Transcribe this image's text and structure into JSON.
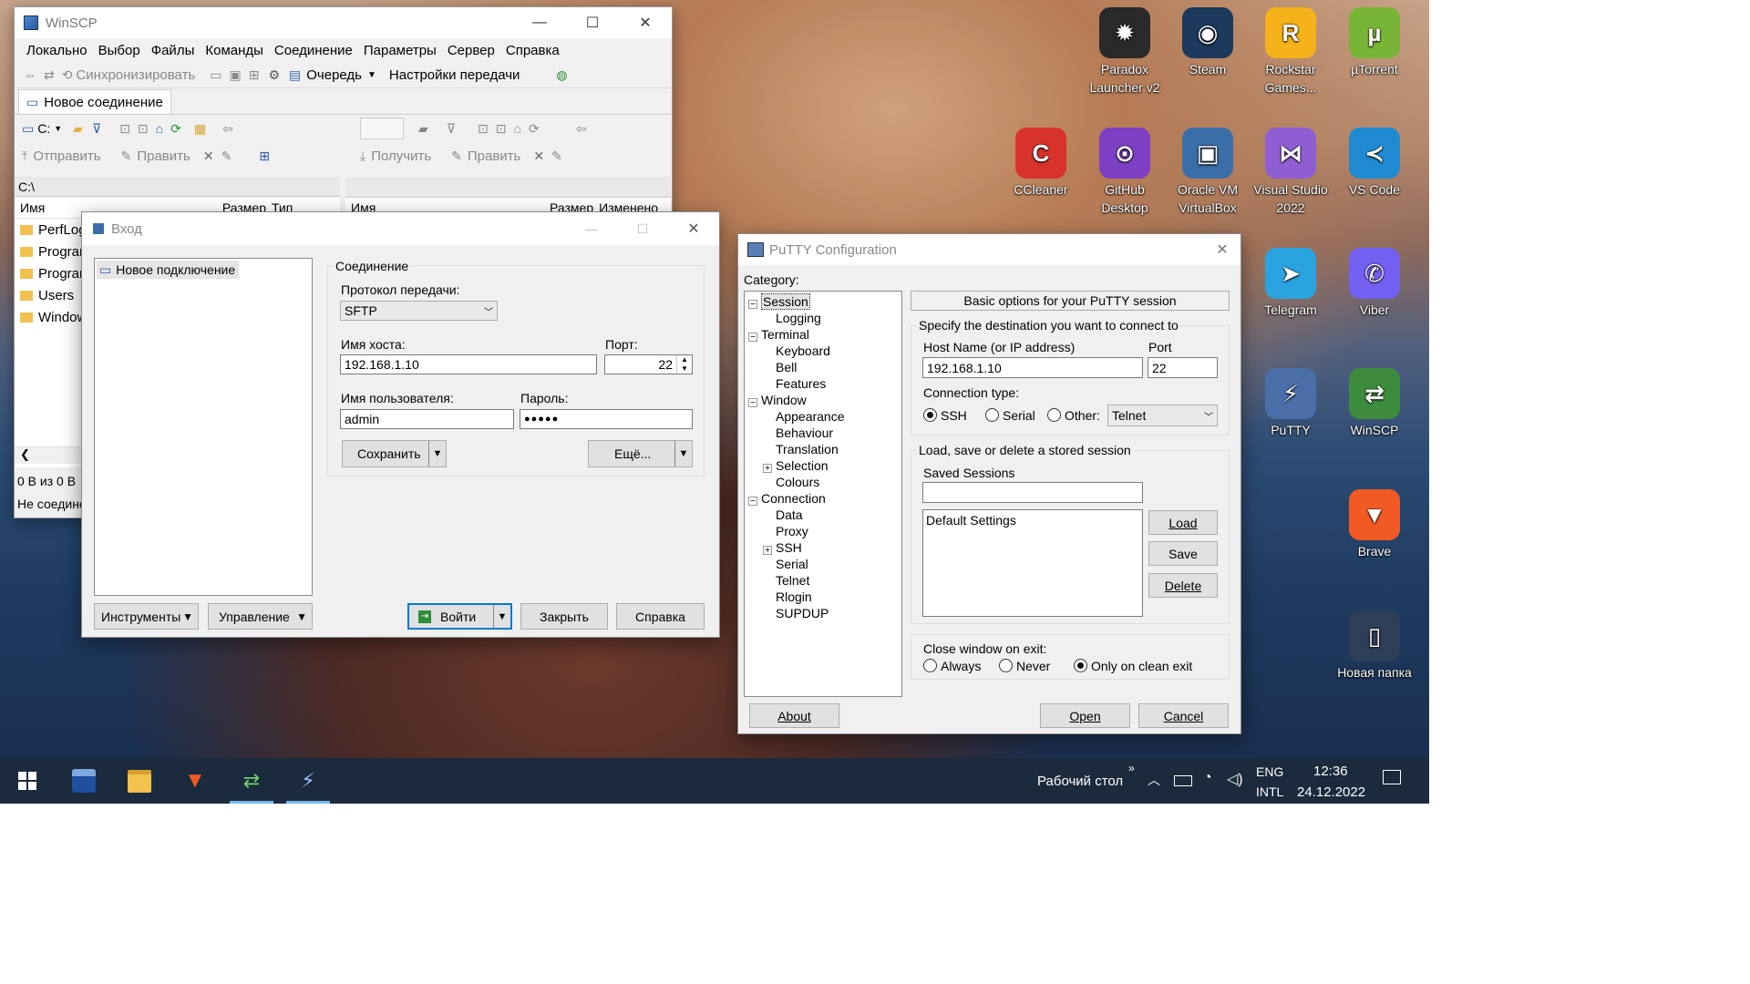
{
  "desktop": {
    "icons": [
      {
        "label": "Paradox Launcher v2",
        "color": "#2a2a2a",
        "glyph": "✹"
      },
      {
        "label": "Steam",
        "color": "#1b3a5c",
        "glyph": "◉"
      },
      {
        "label": "Rockstar Games...",
        "color": "#f6b21a",
        "glyph": "R"
      },
      {
        "label": "µTorrent",
        "color": "#78b536",
        "glyph": "µ"
      },
      {
        "label": "CCleaner",
        "color": "#d8332b",
        "glyph": "C"
      },
      {
        "label": "GitHub Desktop",
        "color": "#7d3fc4",
        "glyph": "⊙"
      },
      {
        "label": "Oracle VM VirtualBox",
        "color": "#3a6ea8",
        "glyph": "▣"
      },
      {
        "label": "Visual Studio 2022",
        "color": "#8f5ed3",
        "glyph": "⋈"
      },
      {
        "label": "VS Code",
        "color": "#1f8ad2",
        "glyph": "≺"
      },
      {
        "label": "Telegram",
        "color": "#2aa3df",
        "glyph": "➤"
      },
      {
        "label": "Viber",
        "color": "#7360f2",
        "glyph": "✆"
      },
      {
        "label": "PuTTY",
        "color": "#4a6fa8",
        "glyph": "⚡"
      },
      {
        "label": "WinSCP",
        "color": "#3d8c3d",
        "glyph": "⇄"
      },
      {
        "label": "Brave",
        "color": "#f25a23",
        "glyph": "▼"
      },
      {
        "label": "Новая папка",
        "color": "#2d3f56",
        "glyph": "▯"
      }
    ]
  },
  "winscp": {
    "title": "WinSCP",
    "menu": [
      "Локально",
      "Выбор",
      "Файлы",
      "Команды",
      "Соединение",
      "Параметры",
      "Сервер",
      "Справка"
    ],
    "toolbar": {
      "sync": "Синхронизировать",
      "queue": "Очередь",
      "transfer_settings": "Настройки передачи"
    },
    "tab": "Новое соединение",
    "drive": "C:",
    "left_actions": {
      "send": "Отправить",
      "edit": "Править"
    },
    "right_actions": {
      "receive": "Получить",
      "edit": "Править"
    },
    "path": "C:\\",
    "left_columns": {
      "name": "Имя",
      "size": "Размер",
      "type": "Тип"
    },
    "right_columns": {
      "name": "Имя",
      "size": "Размер",
      "changed": "Изменено"
    },
    "left_files": [
      "PerfLogs",
      "Program Files",
      "Program Files (x86)",
      "Users",
      "Windows"
    ],
    "status_size": "0 В из 0 В",
    "status_conn": "Не соединено"
  },
  "login": {
    "title": "Вход",
    "site": "Новое подключение",
    "section": "Соединение",
    "protocol_label": "Протокол передачи:",
    "protocol_value": "SFTP",
    "host_label": "Имя хоста:",
    "host_value": "192.168.1.10",
    "port_label": "Порт:",
    "port_value": "22",
    "user_label": "Имя пользователя:",
    "user_value": "admin",
    "pass_label": "Пароль:",
    "pass_value": "●●●●●",
    "save": "Сохранить",
    "more": "Ещё...",
    "tools": "Инструменты",
    "manage": "Управление",
    "login": "Войти",
    "close": "Закрыть",
    "help": "Справка"
  },
  "putty": {
    "title": "PuTTY Configuration",
    "category_label": "Category:",
    "tree": [
      {
        "label": "Session",
        "level": 0,
        "exp": "−"
      },
      {
        "label": "Logging",
        "level": 1,
        "exp": ""
      },
      {
        "label": "Terminal",
        "level": 0,
        "exp": "−"
      },
      {
        "label": "Keyboard",
        "level": 1,
        "exp": ""
      },
      {
        "label": "Bell",
        "level": 1,
        "exp": ""
      },
      {
        "label": "Features",
        "level": 1,
        "exp": ""
      },
      {
        "label": "Window",
        "level": 0,
        "exp": "−"
      },
      {
        "label": "Appearance",
        "level": 1,
        "exp": ""
      },
      {
        "label": "Behaviour",
        "level": 1,
        "exp": ""
      },
      {
        "label": "Translation",
        "level": 1,
        "exp": ""
      },
      {
        "label": "Selection",
        "level": 1,
        "exp": "+"
      },
      {
        "label": "Colours",
        "level": 1,
        "exp": ""
      },
      {
        "label": "Connection",
        "level": 0,
        "exp": "−"
      },
      {
        "label": "Data",
        "level": 1,
        "exp": ""
      },
      {
        "label": "Proxy",
        "level": 1,
        "exp": ""
      },
      {
        "label": "SSH",
        "level": 1,
        "exp": "+"
      },
      {
        "label": "Serial",
        "level": 1,
        "exp": ""
      },
      {
        "label": "Telnet",
        "level": 1,
        "exp": ""
      },
      {
        "label": "Rlogin",
        "level": 1,
        "exp": ""
      },
      {
        "label": "SUPDUP",
        "level": 1,
        "exp": ""
      }
    ],
    "header": "Basic options for your PuTTY session",
    "dest_label": "Specify the destination you want to connect to",
    "host_label": "Host Name (or IP address)",
    "host_value": "192.168.1.10",
    "port_label": "Port",
    "port_value": "22",
    "conn_type_label": "Connection type:",
    "conn_types": {
      "ssh": "SSH",
      "serial": "Serial",
      "other": "Other:"
    },
    "other_value": "Telnet",
    "sessions_group": "Load, save or delete a stored session",
    "saved_label": "Saved Sessions",
    "saved_input": "",
    "sessions": [
      "Default Settings"
    ],
    "load": "Load",
    "save": "Save",
    "delete": "Delete",
    "close_label": "Close window on exit:",
    "close_opts": {
      "always": "Always",
      "never": "Never",
      "clean": "Only on clean exit"
    },
    "about": "About",
    "open": "Open",
    "cancel": "Cancel"
  },
  "taskbar": {
    "desktop_label": "Рабочий стол",
    "lang_top": "ENG",
    "lang_bottom": "INTL",
    "time": "12:36",
    "date": "24.12.2022"
  }
}
